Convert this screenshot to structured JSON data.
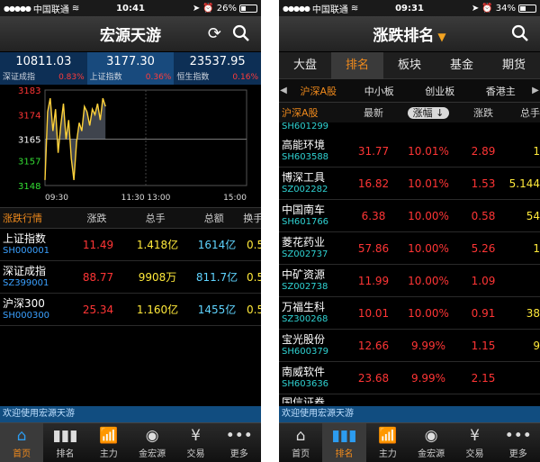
{
  "status_left": {
    "carrier": "中国联通",
    "battery1": "26%",
    "battery2": "34%"
  },
  "screen1": {
    "time": "10:41",
    "title": "宏源天游",
    "indices": [
      {
        "value": "10811.03",
        "name": "深证成指",
        "pct": "0.83%"
      },
      {
        "value": "3177.30",
        "name": "上证指数",
        "pct": "0.36%"
      },
      {
        "value": "23537.95",
        "name": "恒生指数",
        "pct": "0.16%"
      }
    ],
    "chart_data": {
      "type": "line",
      "y_ticks": [
        "3183",
        "3174",
        "3165",
        "3157",
        "3148"
      ],
      "x_ticks": [
        "09:30",
        "11:30 13:00",
        "15:00"
      ],
      "values": [
        3150,
        3175,
        3180,
        3168,
        3176,
        3160,
        3170,
        3178,
        3165,
        3172,
        3158,
        3150,
        3164,
        3171,
        3168,
        3177,
        3175,
        3170,
        3176,
        3174,
        3178,
        3172,
        3180,
        3177
      ]
    },
    "table_header": {
      "section": "涨跌行情",
      "c1": "涨跌",
      "c2": "总手",
      "c3": "总额",
      "c4": "换手"
    },
    "rows": [
      {
        "name": "上证指数",
        "code": "SH000001",
        "change": "11.49",
        "volume": "1.418亿",
        "amount": "1614亿",
        "turn": "0.5"
      },
      {
        "name": "深证成指",
        "code": "SZ399001",
        "change": "88.77",
        "volume": "9908万",
        "amount": "811.7亿",
        "turn": "0.5"
      },
      {
        "name": "沪深300",
        "code": "SH000300",
        "change": "25.34",
        "volume": "1.160亿",
        "amount": "1455亿",
        "turn": "0.5"
      }
    ]
  },
  "screen2": {
    "time": "09:31",
    "title": "涨跌排名",
    "categories": [
      "大盘",
      "排名",
      "板块",
      "基金",
      "期货"
    ],
    "markets": [
      "沪深A股",
      "中小板",
      "创业板",
      "香港主"
    ],
    "table_header": {
      "section": "沪深A股",
      "c1": "最新",
      "c2": "涨幅",
      "c3": "涨跌",
      "c4": "总手"
    },
    "partial_top_code": "SH601299",
    "rows": [
      {
        "name": "高能环境",
        "code": "SH603588",
        "last": "31.77",
        "pct": "10.01%",
        "chg": "2.89",
        "vol": "1"
      },
      {
        "name": "博深工具",
        "code": "SZ002282",
        "last": "16.82",
        "pct": "10.01%",
        "chg": "1.53",
        "vol": "5.144"
      },
      {
        "name": "中国南车",
        "code": "SH601766",
        "last": "6.38",
        "pct": "10.00%",
        "chg": "0.58",
        "vol": "54"
      },
      {
        "name": "菱花药业",
        "code": "SZ002737",
        "last": "57.86",
        "pct": "10.00%",
        "chg": "5.26",
        "vol": "1"
      },
      {
        "name": "中矿资源",
        "code": "SZ002738",
        "last": "11.99",
        "pct": "10.00%",
        "chg": "1.09",
        "vol": ""
      },
      {
        "name": "万福生科",
        "code": "SZ300268",
        "last": "10.01",
        "pct": "10.00%",
        "chg": "0.91",
        "vol": "38"
      },
      {
        "name": "宝光股份",
        "code": "SH600379",
        "last": "12.66",
        "pct": "9.99%",
        "chg": "1.15",
        "vol": "9"
      },
      {
        "name": "南威软件",
        "code": "SH603636",
        "last": "23.68",
        "pct": "9.99%",
        "chg": "2.15",
        "vol": ""
      }
    ],
    "partial_bottom_name": "国信证券"
  },
  "marquee": "欢迎使用宏源天游",
  "tabs": [
    {
      "icon": "home-icon",
      "label": "首页"
    },
    {
      "icon": "bar-chart-icon",
      "label": "排名"
    },
    {
      "icon": "trend-chart-icon",
      "label": "主力"
    },
    {
      "icon": "coin-icon",
      "label": "金宏源"
    },
    {
      "icon": "yen-icon",
      "label": "交易"
    },
    {
      "icon": "more-icon",
      "label": "更多"
    }
  ],
  "colors": {
    "accent": "#f08a1c",
    "up": "#ff3535",
    "code": "#3aa0ff",
    "tab_active": "#2c9cf0"
  }
}
